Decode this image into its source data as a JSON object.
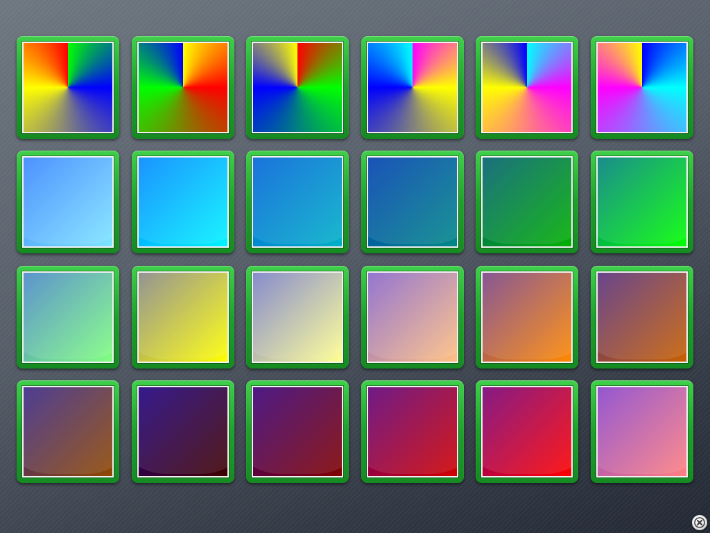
{
  "swatches": [
    {
      "name": "swatch-1-1",
      "style": "conic",
      "colors": [
        "#00ff00",
        "#0000ff",
        "#ffff00",
        "#ff0000"
      ]
    },
    {
      "name": "swatch-1-2",
      "style": "conic",
      "colors": [
        "#ffff00",
        "#ff0000",
        "#00ff00",
        "#0000ff"
      ]
    },
    {
      "name": "swatch-1-3",
      "style": "conic",
      "colors": [
        "#ff0000",
        "#00ff00",
        "#0000ff",
        "#ffff00"
      ]
    },
    {
      "name": "swatch-1-4",
      "style": "conic",
      "colors": [
        "#ff00ff",
        "#ffff00",
        "#0000ff",
        "#00ffff"
      ]
    },
    {
      "name": "swatch-1-5",
      "style": "conic",
      "colors": [
        "#00ffff",
        "#ff00ff",
        "#ffff00",
        "#0000ff"
      ]
    },
    {
      "name": "swatch-1-6",
      "style": "conic",
      "colors": [
        "#0000ff",
        "#00ffff",
        "#ff00ff",
        "#ffff00"
      ]
    },
    {
      "name": "swatch-2-1",
      "style": "linear",
      "colors": [
        "#3a86ff",
        "#7fe6ff"
      ]
    },
    {
      "name": "swatch-2-2",
      "style": "linear",
      "colors": [
        "#0088ff",
        "#00f4ff"
      ]
    },
    {
      "name": "swatch-2-3",
      "style": "linear",
      "colors": [
        "#0064d8",
        "#00b0c8"
      ]
    },
    {
      "name": "swatch-2-4",
      "style": "linear",
      "colors": [
        "#0040b0",
        "#008888"
      ]
    },
    {
      "name": "swatch-2-5",
      "style": "linear",
      "colors": [
        "#006070",
        "#00b000"
      ]
    },
    {
      "name": "swatch-2-6",
      "style": "linear",
      "colors": [
        "#008080",
        "#00ff00"
      ]
    },
    {
      "name": "swatch-3-1",
      "style": "linear",
      "colors": [
        "#4a88c8",
        "#80ff80"
      ]
    },
    {
      "name": "swatch-3-2",
      "style": "linear",
      "colors": [
        "#888888",
        "#ffff00"
      ]
    },
    {
      "name": "swatch-3-3",
      "style": "linear",
      "colors": [
        "#7a80c8",
        "#ffff90"
      ]
    },
    {
      "name": "swatch-3-4",
      "style": "linear",
      "colors": [
        "#8866cc",
        "#ffc080"
      ]
    },
    {
      "name": "swatch-3-5",
      "style": "linear",
      "colors": [
        "#7a4488",
        "#ff8800"
      ]
    },
    {
      "name": "swatch-3-6",
      "style": "linear",
      "colors": [
        "#583080",
        "#c86000"
      ]
    },
    {
      "name": "swatch-4-1",
      "style": "linear",
      "colors": [
        "#3a2888",
        "#904800"
      ]
    },
    {
      "name": "swatch-4-2",
      "style": "linear",
      "colors": [
        "#200080",
        "#400000"
      ]
    },
    {
      "name": "swatch-4-3",
      "style": "linear",
      "colors": [
        "#3a0078",
        "#800000"
      ]
    },
    {
      "name": "swatch-4-4",
      "style": "linear",
      "colors": [
        "#60007a",
        "#d00000"
      ]
    },
    {
      "name": "swatch-4-5",
      "style": "linear",
      "colors": [
        "#780078",
        "#ff0000"
      ]
    },
    {
      "name": "swatch-4-6",
      "style": "linear",
      "colors": [
        "#8844cc",
        "#ff8080"
      ]
    }
  ],
  "colors": {
    "frame": "#1ea12c",
    "border": "#f2f2f2"
  },
  "close": {
    "icon": "close-icon"
  }
}
